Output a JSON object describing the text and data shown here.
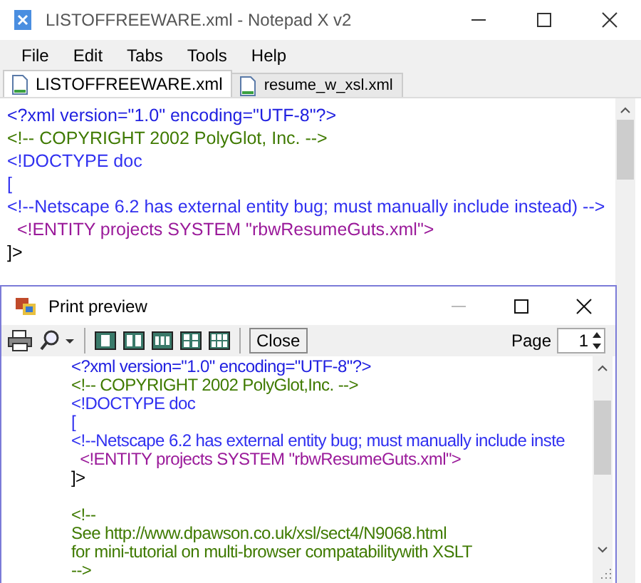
{
  "window": {
    "title": "LISTOFFREEWARE.xml - Notepad X v2"
  },
  "menu": [
    "File",
    "Edit",
    "Tabs",
    "Tools",
    "Help"
  ],
  "tabs": [
    {
      "label": "LISTOFFREEWARE.xml",
      "selected": true
    },
    {
      "label": "resume_w_xsl.xml",
      "selected": false
    }
  ],
  "editor": {
    "lines": [
      {
        "kind": "pi",
        "text": "<?xml version=\"1.0\" encoding=\"UTF-8\"?>"
      },
      {
        "kind": "comment",
        "text": "<!-- COPYRIGHT 2002 PolyGlot, Inc. -->"
      },
      {
        "kind": "markup",
        "text": "<!DOCTYPE doc"
      },
      {
        "kind": "markup",
        "text": "["
      },
      {
        "kind": "markup",
        "text": "<!--Netscape 6.2 has external entity bug; must manually include instead) -->"
      },
      {
        "kind": "entity",
        "text": "  <!ENTITY projects SYSTEM \"rbwResumeGuts.xml\">"
      },
      {
        "kind": "text",
        "text": "]>"
      }
    ]
  },
  "preview": {
    "title": "Print preview",
    "close_button": "Close",
    "page_label": "Page",
    "page_value": "1",
    "lines": [
      {
        "kind": "pi",
        "text": "<?xml version=\"1.0\" encoding=\"UTF-8\"?>"
      },
      {
        "kind": "comment",
        "text": "<!-- COPYRIGHT 2002 PolyGlot,Inc. -->"
      },
      {
        "kind": "markup",
        "text": "<!DOCTYPE doc"
      },
      {
        "kind": "markup",
        "text": "["
      },
      {
        "kind": "markup",
        "text": "<!--Netscape 6.2 has external entity bug; must manually include inste"
      },
      {
        "kind": "entity",
        "text": "  <!ENTITY projects SYSTEM \"rbwResumeGuts.xml\">"
      },
      {
        "kind": "text",
        "text": "]>"
      },
      {
        "kind": "blank"
      },
      {
        "kind": "comment",
        "text": "<!--"
      },
      {
        "kind": "comment",
        "text": "See http://www.dpawson.co.uk/xsl/sect4/N9068.html"
      },
      {
        "kind": "comment",
        "text": "for mini-tutorial on multi-browser compatabilitywith XSLT"
      },
      {
        "kind": "comment",
        "text": "-->"
      }
    ]
  }
}
